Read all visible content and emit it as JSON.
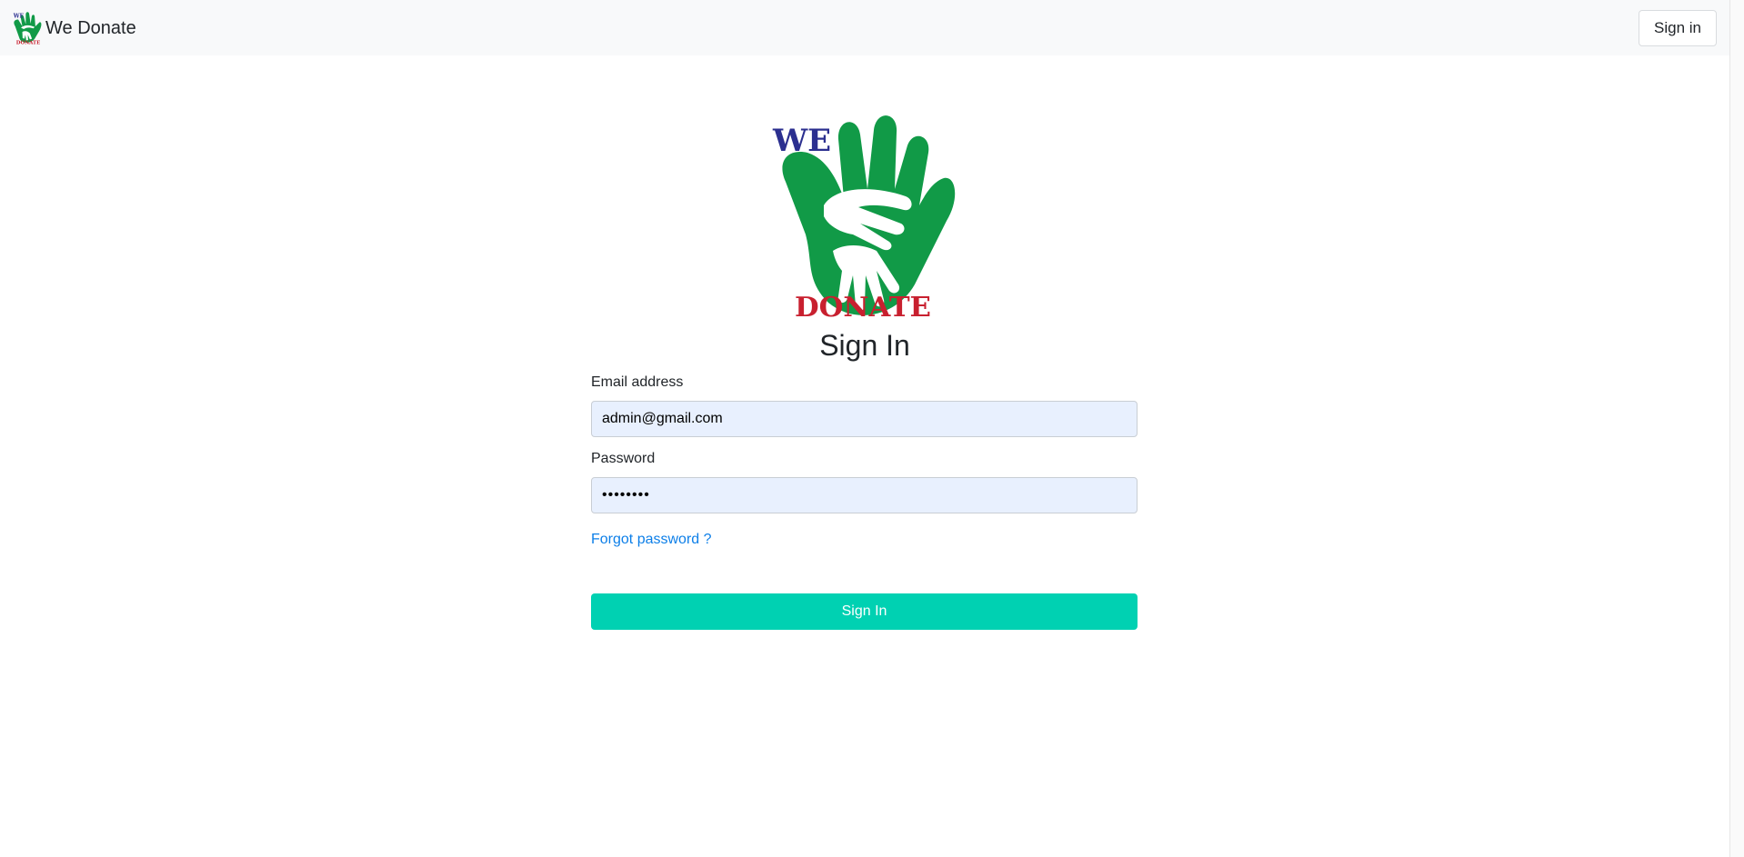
{
  "navbar": {
    "brand_name": "We Donate",
    "brand_icon": "hands-logo-icon",
    "signin_label": "Sign in"
  },
  "logo": {
    "top_word": "WE",
    "bottom_word": "DONATE",
    "icon": "hands-logo-icon"
  },
  "form": {
    "title": "Sign In",
    "email_label": "Email address",
    "email_value": "admin@gmail.com",
    "password_label": "Password",
    "password_mask": "••••••••",
    "forgot_label": "Forgot password ?",
    "submit_label": "Sign In"
  },
  "colors": {
    "brand_green": "#119a47",
    "brand_blue": "#2b2f8f",
    "brand_red": "#c8202f",
    "primary_button": "#00d1b2",
    "link": "#0d7fe8",
    "input_autofill_bg": "#e8f0fe",
    "navbar_bg": "#f8f9fa"
  }
}
